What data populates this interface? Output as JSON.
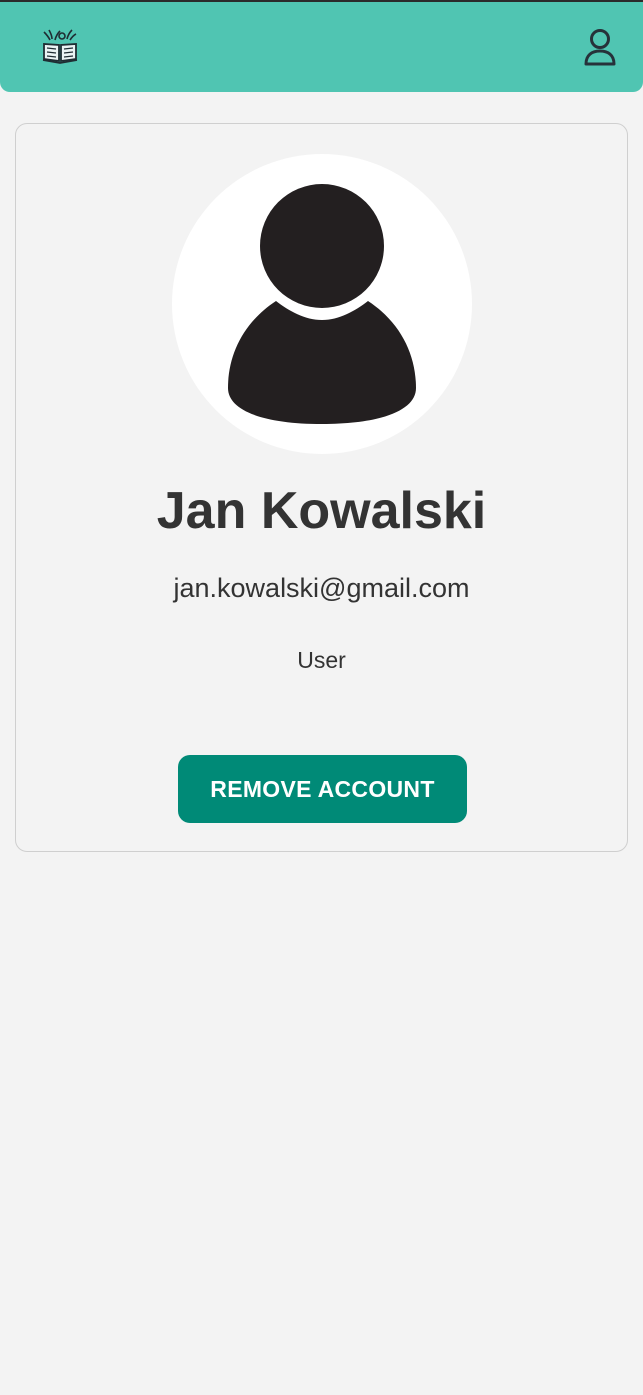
{
  "header": {
    "logo_icon": "open-book-icon",
    "profile_icon": "user-outline-icon",
    "background_color": "#50c5b2"
  },
  "profile": {
    "avatar_icon": "user-silhouette-icon",
    "name": "Jan Kowalski",
    "email": "jan.kowalski@gmail.com",
    "role": "User"
  },
  "actions": {
    "remove_account_label": "REMOVE ACCOUNT",
    "remove_account_color": "#008a77"
  }
}
